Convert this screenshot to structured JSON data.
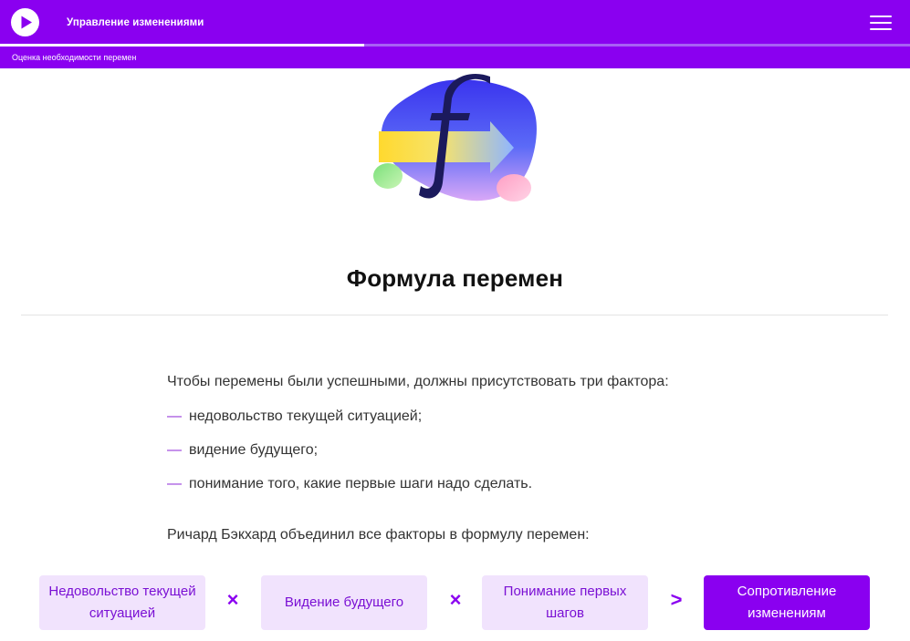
{
  "header": {
    "app_title": "Управление изменениями",
    "breadcrumb": "Оценка необходимости перемен",
    "progress": 0.4
  },
  "icons": {
    "play": "play-icon",
    "menu": "hamburger-menu-icon",
    "hero": "formula-f-illustration"
  },
  "colors": {
    "accent": "#8a00f0",
    "box_bg": "#f1e3fd",
    "box_text": "#7a10d4"
  },
  "content": {
    "title": "Формула перемен",
    "intro": "Чтобы перемены были успешными, должны присутствовать три фактора:",
    "factors": [
      "недовольство текущей ситуацией;",
      "видение будущего;",
      "понимание того, какие первые шаги надо сделать."
    ],
    "bullet": "—",
    "outro": "Ричард Бэкхард объединил все факторы в формулу перемен:"
  },
  "formula": {
    "box1": "Недовольство текущей ситуацией",
    "op1": "×",
    "box2": "Видение будущего",
    "op2": "×",
    "box3": "Понимание первых шагов",
    "op3": ">",
    "result": "Сопротивление изменениям"
  }
}
